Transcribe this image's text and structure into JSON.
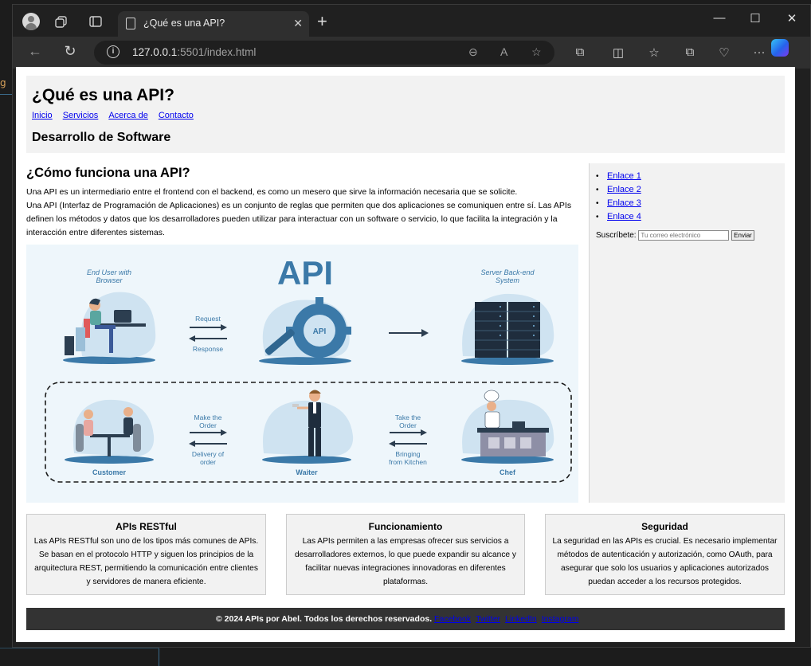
{
  "desktop": {
    "left_fragment": "g"
  },
  "browser": {
    "tab_title": "¿Qué es una API?",
    "url_host": "127.0.0.1",
    "url_rest": ":5501/index.html",
    "accent": "#0000ee"
  },
  "header": {
    "title": "¿Qué es una API?",
    "nav": [
      "Inicio",
      "Servicios",
      "Acerca de",
      "Contacto"
    ],
    "subtitle": "Desarrollo de Software"
  },
  "main": {
    "heading": "¿Cómo funciona una API?",
    "p1": "Una API es un intermediario entre el frontend con el backend, es como un mesero que sirve la información necesaria que se solicite.",
    "p2": "Una API (Interfaz de Programación de Aplicaciones) es un conjunto de reglas que permiten que dos aplicaciones se comuniquen entre sí. Las APIs definen los métodos y datos que los desarrolladores pueden utilizar para interactuar con un software o servicio, lo que facilita la integración y la interacción entre diferentes sistemas.",
    "diagram": {
      "api_label": "API",
      "gear_label": "API",
      "top_left": [
        "End User with",
        "Browser"
      ],
      "top_right": [
        "Server Back-end",
        "System"
      ],
      "request": "Request",
      "response": "Response",
      "make_order": [
        "Make the",
        "Order"
      ],
      "delivery": [
        "Delivery of",
        "order"
      ],
      "take_order": [
        "Take the",
        "Order"
      ],
      "bringing": [
        "Bringing",
        "from Kitchen"
      ],
      "customer": "Customer",
      "waiter": "Waiter",
      "chef": "Chef"
    }
  },
  "sidebar": {
    "links": [
      "Enlace 1",
      "Enlace 2",
      "Enlace 3",
      "Enlace 4"
    ],
    "subscribe_label": "Suscríbete:",
    "email_placeholder": "Tu correo electrónico",
    "send_label": "Enviar"
  },
  "cards": [
    {
      "title": "APIs RESTful",
      "text": "Las APIs RESTful son uno de los tipos más comunes de APIs. Se basan en el protocolo HTTP y siguen los principios de la arquitectura REST, permitiendo la comunicación entre clientes y servidores de manera eficiente."
    },
    {
      "title": "Funcionamiento",
      "text": "Las APIs permiten a las empresas ofrecer sus servicios a desarrolladores externos, lo que puede expandir su alcance y facilitar nuevas integraciones innovadoras en diferentes plataformas."
    },
    {
      "title": "Seguridad",
      "text": "La seguridad en las APIs es crucial. Es necesario implementar métodos de autenticación y autorización, como OAuth, para asegurar que solo los usuarios y aplicaciones autorizados puedan acceder a los recursos protegidos."
    }
  ],
  "footer": {
    "text": "© 2024 APIs por Abel. Todos los derechos reservados.",
    "links": [
      "Facebook",
      "Twitter",
      "LinkedIn",
      "Instagram"
    ]
  }
}
